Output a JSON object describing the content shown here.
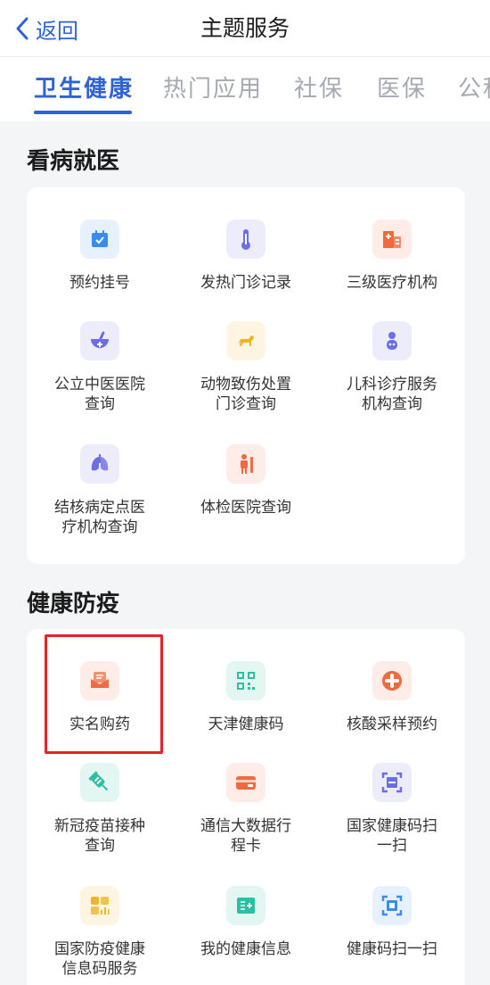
{
  "header": {
    "back_label": "返回",
    "title": "主题服务"
  },
  "tabs": [
    {
      "label": "卫生健康",
      "active": true
    },
    {
      "label": "热门应用"
    },
    {
      "label": "社保"
    },
    {
      "label": "医保"
    },
    {
      "label": "公积"
    }
  ],
  "sections": [
    {
      "title": "看病就医",
      "items": [
        {
          "label": "预约挂号",
          "icon": "calendar-icon",
          "bg": "#e7f1fd",
          "color": "#3a8cf0"
        },
        {
          "label": "发热门诊记录",
          "icon": "thermometer-icon",
          "bg": "#ececfb",
          "color": "#6b6fe6"
        },
        {
          "label": "三级医疗机构",
          "icon": "hospital-icon",
          "bg": "#fdece7",
          "color": "#f0693f"
        },
        {
          "label": "公立中医医院\n查询",
          "icon": "mortar-icon",
          "bg": "#ececfb",
          "color": "#6b6fe6"
        },
        {
          "label": "动物致伤处置\n门诊查询",
          "icon": "dog-icon",
          "bg": "#fdf5e1",
          "color": "#f0b429"
        },
        {
          "label": "儿科诊疗服务\n机构查询",
          "icon": "baby-icon",
          "bg": "#ececfb",
          "color": "#6b6fe6"
        },
        {
          "label": "结核病定点医\n疗机构查询",
          "icon": "lungs-icon",
          "bg": "#ececfb",
          "color": "#6b6fe6"
        },
        {
          "label": "体检医院查询",
          "icon": "body-check-icon",
          "bg": "#fdece7",
          "color": "#f0693f"
        }
      ]
    },
    {
      "title": "健康防疫",
      "items": [
        {
          "label": "实名购药",
          "icon": "medicine-box-icon",
          "bg": "#fdece7",
          "color": "#f0693f"
        },
        {
          "label": "天津健康码",
          "icon": "qr-code-icon",
          "bg": "#e3f6f2",
          "color": "#2dbfa2"
        },
        {
          "label": "核酸采样预约",
          "icon": "medical-cross-icon",
          "bg": "#fdece7",
          "color": "#f0693f"
        },
        {
          "label": "新冠疫苗接种\n查询",
          "icon": "syringe-icon",
          "bg": "#e3f6f2",
          "color": "#2dbfa2"
        },
        {
          "label": "通信大数据行\n程卡",
          "icon": "card-icon",
          "bg": "#fdece7",
          "color": "#f0693f"
        },
        {
          "label": "国家健康码扫\n一扫",
          "icon": "scan-icon",
          "bg": "#ececfb",
          "color": "#6b6fe6"
        },
        {
          "label": "国家防疫健康\n信息码服务",
          "icon": "grid-chart-icon",
          "bg": "#fdf5e1",
          "color": "#f0b429"
        },
        {
          "label": "我的健康信息",
          "icon": "health-card-icon",
          "bg": "#e3f6f2",
          "color": "#2dbfa2"
        },
        {
          "label": "健康码扫一扫",
          "icon": "scan-frame-icon",
          "bg": "#e7f1fd",
          "color": "#3a8cf0"
        }
      ]
    }
  ]
}
